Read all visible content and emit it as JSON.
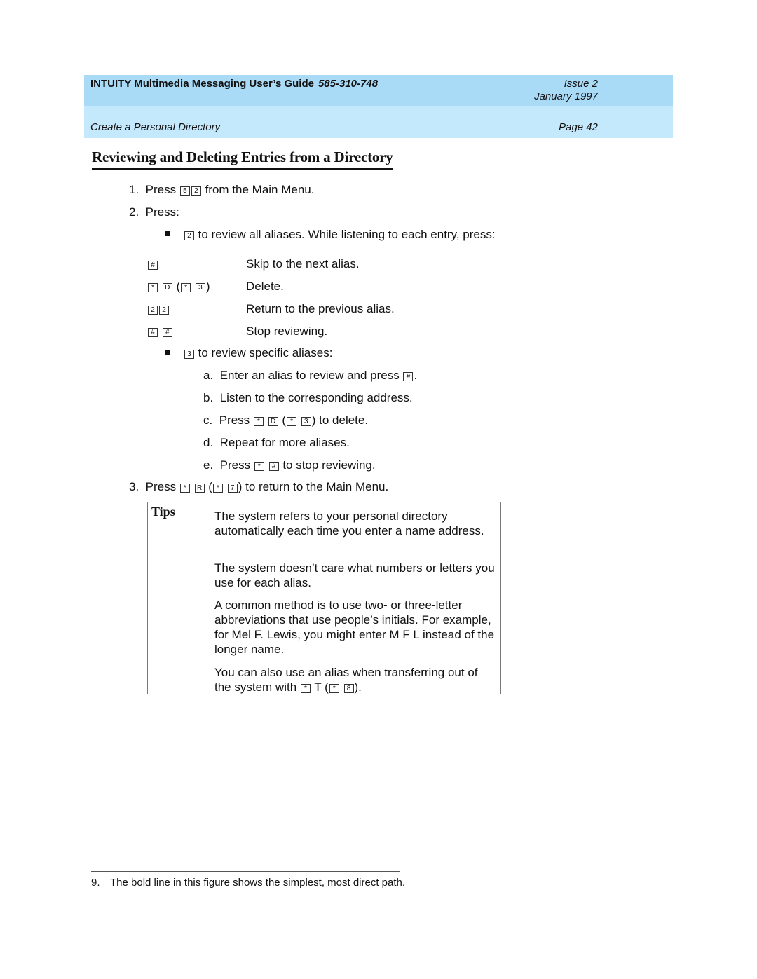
{
  "header": {
    "guide_title": "INTUITY Multimedia Messaging User’s Guide",
    "doc_number": "585-310-748",
    "issue": "Issue 2",
    "date": "January 1997",
    "section": "Create a Personal Directory",
    "page": "Page 42"
  },
  "page_title": "Reviewing and Deleting Entries from a Directory",
  "steps": {
    "s1": {
      "num": "1.",
      "pre": "Press",
      "keys": [
        "5",
        "2"
      ],
      "post": "from the Main Menu."
    },
    "s2": {
      "num": "2.",
      "text": "Press:"
    },
    "b1": {
      "key": "2",
      "text": "to review all aliases. While listening to each entry, press:"
    },
    "table": [
      {
        "keys_text": "#",
        "action": "Skip to the next alias."
      },
      {
        "keys_text": "* D (* 3)",
        "action": "Delete."
      },
      {
        "keys_text": "2 2",
        "action": "Return to the previous alias."
      },
      {
        "keys_text": "# #",
        "action": "Stop reviewing."
      }
    ],
    "b2": {
      "key": "3",
      "text": "to review specific aliases:"
    },
    "sub": [
      {
        "letter": "a.",
        "text": "Enter an alias to review and press",
        "end": "."
      },
      {
        "letter": "b.",
        "text": "Listen to the corresponding address."
      },
      {
        "letter": "c.",
        "pre": "Press",
        "post": "to delete."
      },
      {
        "letter": "d.",
        "text": "Repeat for more aliases."
      },
      {
        "letter": "e.",
        "pre": "Press",
        "post": "to stop reviewing."
      }
    ],
    "s3": {
      "num": "3.",
      "pre": "Press",
      "post": "to return to the Main Menu."
    }
  },
  "keys": {
    "hash": "#",
    "star": "*",
    "d": "D",
    "r": "R",
    "t": "T",
    "k2": "2",
    "k3": "3",
    "k5": "5",
    "k7": "7",
    "k8": "8"
  },
  "tips": {
    "label": "Tips",
    "p1": "The system refers to your personal directory automatically each time you enter a name address.",
    "p2": "The system doesn’t care what numbers or letters you use for each alias.",
    "p3": "A common method is to use two- or three-letter abbreviations that use people’s initials.  For example, for Mel F. Lewis, you might enter M F L instead of the longer name.",
    "p4_pre": "You can also use an alias when transferring out of the system with",
    "p4_t": "T",
    "p4_end": ")."
  },
  "footnote": {
    "num": "9.",
    "text": "The bold line in this figure shows the simplest, most direct path."
  }
}
